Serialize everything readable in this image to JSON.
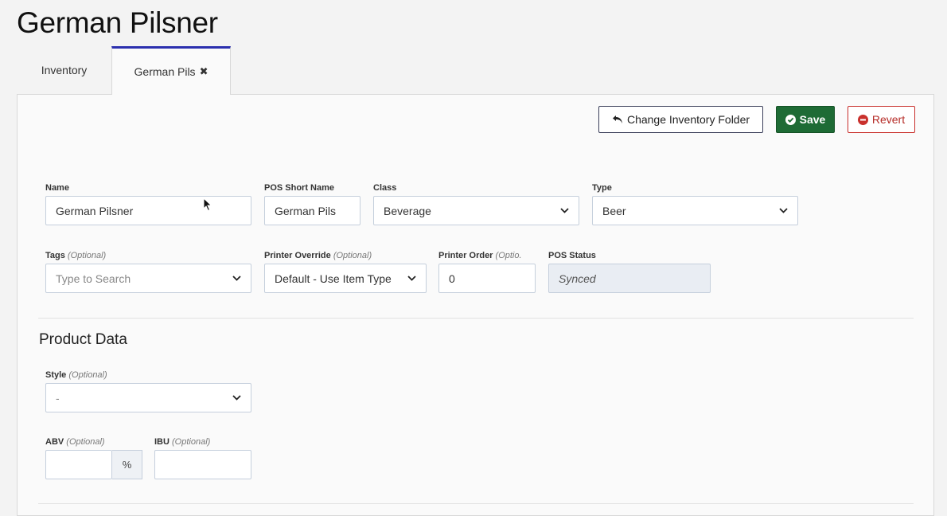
{
  "page": {
    "title": "German Pilsner"
  },
  "tabs": [
    {
      "label": "Inventory"
    },
    {
      "label": "German Pils",
      "close_icon": "close-icon"
    }
  ],
  "toolbar": {
    "change_folder_label": "Change Inventory Folder",
    "save_label": "Save",
    "revert_label": "Revert"
  },
  "form": {
    "name": {
      "label": "Name",
      "value": "German Pilsner"
    },
    "pos_short_name": {
      "label": "POS Short Name",
      "value": "German Pils"
    },
    "class": {
      "label": "Class",
      "value": "Beverage"
    },
    "type": {
      "label": "Type",
      "value": "Beer"
    },
    "tags": {
      "label": "Tags",
      "optional": "(Optional)",
      "placeholder": "Type to Search"
    },
    "printer_override": {
      "label": "Printer Override",
      "optional": "(Optional)",
      "value": "Default - Use Item Type"
    },
    "printer_order": {
      "label": "Printer Order",
      "optional": "(Optio.",
      "value": "0"
    },
    "pos_status": {
      "label": "POS Status",
      "value": "Synced"
    }
  },
  "product_data": {
    "title": "Product Data",
    "style": {
      "label": "Style",
      "optional": "(Optional)",
      "value": "-"
    },
    "abv": {
      "label": "ABV",
      "optional": "(Optional)",
      "value": "",
      "addon": "%"
    },
    "ibu": {
      "label": "IBU",
      "optional": "(Optional)",
      "value": ""
    }
  },
  "colors": {
    "accent": "#2b2fae",
    "save": "#1e6b35",
    "revert": "#c9302c"
  }
}
